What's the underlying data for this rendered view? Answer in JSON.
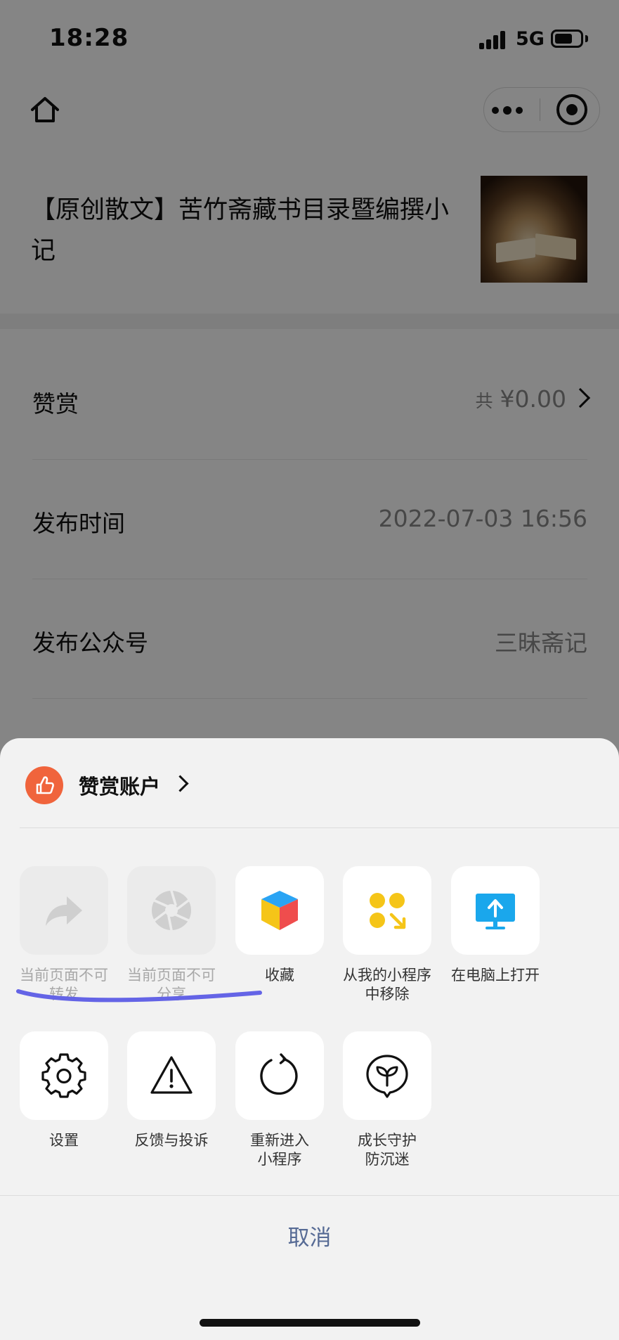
{
  "status_bar": {
    "time": "18:28",
    "network": "5G"
  },
  "nav": {
    "home_icon": "home-icon",
    "more_icon": "more-dots-icon",
    "close_icon": "target-close-icon"
  },
  "article": {
    "title": "【原创散文】苦竹斋藏书目录暨编撰小记"
  },
  "info_rows": {
    "reward": {
      "label": "赞赏",
      "prefix": "共",
      "value": "¥0.00"
    },
    "publish_time": {
      "label": "发布时间",
      "value": "2022-07-03 16:56"
    },
    "publish_account": {
      "label": "发布公众号",
      "value": "三昧斋记"
    }
  },
  "sheet": {
    "account_label": "赞赏账户",
    "actions_row1": [
      {
        "label": "当前页面不可\n转发",
        "icon": "forward-icon",
        "disabled": true
      },
      {
        "label": "当前页面不可\n分享",
        "icon": "aperture-share-icon",
        "disabled": true
      },
      {
        "label": "收藏",
        "icon": "favorite-cube-icon",
        "disabled": false
      },
      {
        "label": "从我的小程序\n中移除",
        "icon": "remove-miniprogram-icon",
        "disabled": false
      },
      {
        "label": "在电脑上打开",
        "icon": "open-on-pc-icon",
        "disabled": false
      }
    ],
    "actions_row2": [
      {
        "label": "设置",
        "icon": "gear-icon"
      },
      {
        "label": "反馈与投诉",
        "icon": "warning-icon"
      },
      {
        "label": "重新进入\n小程序",
        "icon": "reload-icon"
      },
      {
        "label": "成长守护\n防沉迷",
        "icon": "sprout-shield-icon"
      }
    ],
    "cancel_label": "取消"
  },
  "colors": {
    "cancel_text": "#576b95",
    "reward_account_icon": "#f0643c",
    "annotation_underline": "#6464e6",
    "favorite_cube": [
      "#2aa4f4",
      "#f5c518",
      "#ef4d4d"
    ],
    "remove_dots": "#f5c518",
    "pc_icon": "#1aa7ec"
  }
}
